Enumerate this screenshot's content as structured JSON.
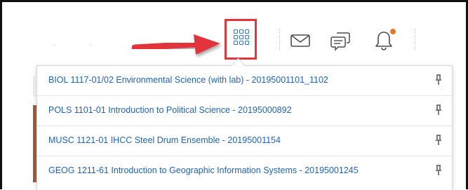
{
  "navbar": {
    "icons": [
      {
        "name": "course-selector-waffle-icon",
        "highlighted": true,
        "color": "#2a73c5"
      },
      {
        "name": "message-alerts-mail-icon"
      },
      {
        "name": "subscription-alerts-chat-icon"
      },
      {
        "name": "update-alerts-bell-icon",
        "badge_color": "#e87722"
      }
    ],
    "annotation_arrow_color": "#e2363b"
  },
  "course_list": {
    "link_color": "#1e64b4",
    "courses": [
      {
        "label": "BIOL 1117-01/02 Environmental Science (with lab) - 20195001101_1102"
      },
      {
        "label": "POLS 1101-01 Introduction to Political Science - 20195000892"
      },
      {
        "label": "MUSC 1121-01 IHCC Steel Drum Ensemble - 20195001154"
      },
      {
        "label": "GEOG 1211-61 Introduction to Geographic Information Systems - 20195001245"
      }
    ]
  }
}
